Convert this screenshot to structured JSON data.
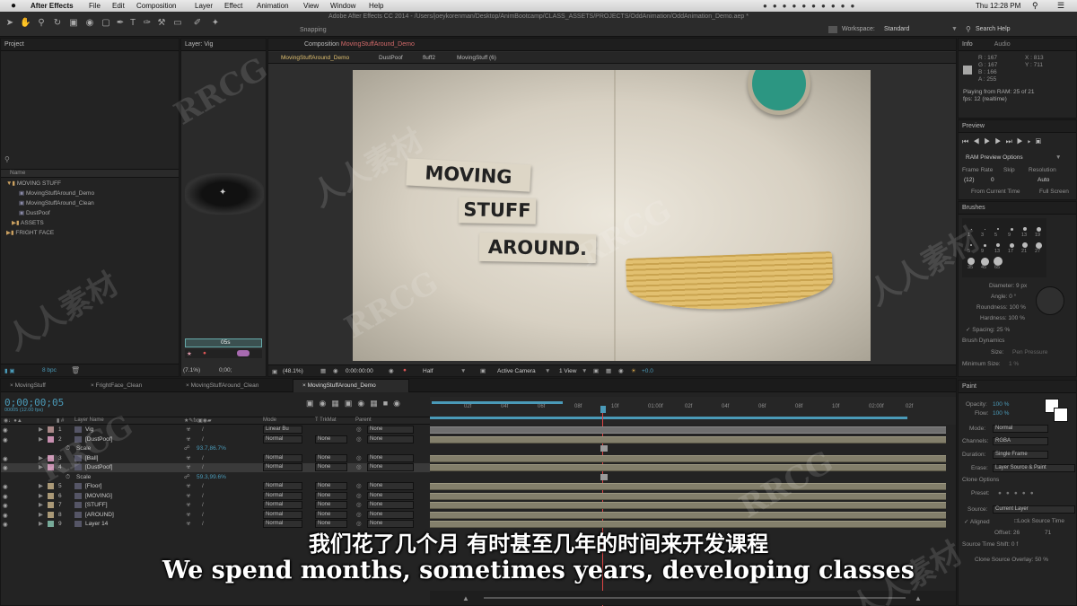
{
  "menubar": {
    "app": "After Effects",
    "items": [
      "File",
      "Edit",
      "Composition",
      "Layer",
      "Effect",
      "Animation",
      "View",
      "Window",
      "Help"
    ],
    "clock": "Thu 12:28 PM"
  },
  "window_title": "Adobe After Effects CC 2014 - /Users/joeykorenman/Desktop/AnimBootcamp/CLASS_ASSETS/PROJECTS/OddAnimation/OddAnimation_Demo.aep *",
  "toolbar": {
    "snapping": "Snapping",
    "workspace_label": "Workspace:",
    "workspace_value": "Standard",
    "search_help": "Search Help"
  },
  "project": {
    "tab": "Project",
    "col_name": "Name",
    "items": [
      "MOVING STUFF",
      "MovingStuffAround_Demo",
      "MovingStuffAround_Clean",
      "DustPoof",
      "ASSETS",
      "FRIGHT FACE"
    ],
    "bpc": "8 bpc"
  },
  "layer_panel": {
    "tab": "Layer: Vig",
    "time": "0;00;"
  },
  "composition": {
    "tab": "Composition",
    "tab_name": "MovingStuffAround_Demo",
    "breadcrumbs": [
      "MovingStuffAround_Demo",
      "DustPoof",
      "fluff2",
      "MovingStuff (6)"
    ],
    "zoom": "(48.1%)",
    "timecode": "0:00:00:00",
    "resolution": "Half",
    "camera": "Active Camera",
    "view": "1 View",
    "exposure": "+0.0",
    "art_lines": [
      "MOVING",
      "STUFF",
      "AROUND."
    ]
  },
  "left_zoom": "(7.1%)",
  "left_time": "0:00;",
  "info": {
    "tab": "Info",
    "tab2": "Audio",
    "r": "R : 167",
    "g": "G : 167",
    "b": "B : 166",
    "a": "A : 255",
    "x": "X : 813",
    "y": "Y : 711",
    "playing": "Playing from RAM: 25 of 21",
    "fps": "fps: 12 (realtime)"
  },
  "preview": {
    "tab": "Preview",
    "ram_options": "RAM Preview Options",
    "frame_rate_label": "Frame Rate",
    "skip_label": "Skip",
    "resolution_label": "Resolution",
    "frame_rate": "(12)",
    "skip": "0",
    "resolution": "Auto",
    "from_current": "From Current Time",
    "full_screen": "Full Screen"
  },
  "brushes": {
    "tab": "Brushes",
    "sizes": [
      "1",
      "3",
      "5",
      "9",
      "13",
      "19",
      "5",
      "9",
      "13",
      "17",
      "21",
      "27",
      "35",
      "45",
      "65"
    ],
    "diameter": "Diameter: 9 px",
    "angle": "Angle: 0 °",
    "roundness": "Roundness: 100 %",
    "hardness": "Hardness: 100 %",
    "spacing": "Spacing: 25 %",
    "dynamics": "Brush Dynamics",
    "size": "Size:",
    "size_val": "Pen Pressure",
    "min_size": "Minimum Size:",
    "min_size_val": "1 %"
  },
  "paint": {
    "tab": "Paint",
    "opacity": "Opacity:",
    "opacity_val": "100 %",
    "flow": "Flow:",
    "flow_val": "100 %",
    "mode": "Mode:",
    "mode_val": "Normal",
    "channels": "Channels:",
    "channels_val": "RGBA",
    "duration": "Duration:",
    "duration_val": "Single Frame",
    "erase": "Erase:",
    "erase_val": "Layer Source & Paint",
    "clone_options": "Clone Options",
    "preset": "Preset:",
    "source": "Source:",
    "source_val": "Current Layer",
    "aligned": "Aligned",
    "lock_source": "Lock Source Time",
    "offset": "Offset: 26",
    "offset2": "71",
    "source_shift": "Source Time Shift: 0 f",
    "clone_overlay": "Clone Source Overlay: 50 %"
  },
  "timeline": {
    "tabs": [
      "MovingStuff",
      "FrightFace_Clean",
      "MovingStuffAround_Clean",
      "MovingStuffAround_Demo"
    ],
    "timecode": "0;00;00;05",
    "timecode_sub": "00005 (12.00 fps)",
    "cols": {
      "layer_name": "Layer Name",
      "mode": "Mode",
      "trkmat": "TrkMat",
      "parent": "Parent"
    },
    "ruler": [
      "02f",
      "04f",
      "06f",
      "08f",
      "10f",
      "01:00f",
      "02f",
      "04f",
      "06f",
      "08f",
      "10f",
      "02:00f",
      "02f"
    ],
    "layers": [
      {
        "num": "1",
        "name": "Vig",
        "mode": "Linear Bu",
        "trk": "",
        "parent": "None"
      },
      {
        "num": "2",
        "name": "[DustPoof]",
        "mode": "Normal",
        "trk": "None",
        "parent": "None"
      },
      {
        "num": "",
        "name": "Scale",
        "mode": "",
        "trk": "",
        "parent": "",
        "value": "93.7,86.7%"
      },
      {
        "num": "3",
        "name": "[Ball]",
        "mode": "Normal",
        "trk": "None",
        "parent": "None"
      },
      {
        "num": "4",
        "name": "[DustPoof]",
        "mode": "Normal",
        "trk": "None",
        "parent": "None"
      },
      {
        "num": "",
        "name": "Scale",
        "mode": "",
        "trk": "",
        "parent": "",
        "value": "59.3,99.6%"
      },
      {
        "num": "5",
        "name": "[Floor]",
        "mode": "Normal",
        "trk": "None",
        "parent": "None"
      },
      {
        "num": "6",
        "name": "[MOVING]",
        "mode": "Normal",
        "trk": "None",
        "parent": "None"
      },
      {
        "num": "7",
        "name": "[STUFF]",
        "mode": "Normal",
        "trk": "None",
        "parent": "None"
      },
      {
        "num": "8",
        "name": "[AROUND]",
        "mode": "Normal",
        "trk": "None",
        "parent": "None"
      },
      {
        "num": "9",
        "name": "Layer 14",
        "mode": "Normal",
        "trk": "None",
        "parent": "None"
      }
    ]
  },
  "subtitles": {
    "zh": "我们花了几个月 有时甚至几年的时间来开发课程",
    "en": "We spend months, sometimes years, developing classes"
  },
  "watermarks": [
    "RRCG",
    "人人素材",
    "RRCG",
    "人人素材",
    "RRCG",
    "人人素材",
    "RRCG",
    "人人素材"
  ]
}
